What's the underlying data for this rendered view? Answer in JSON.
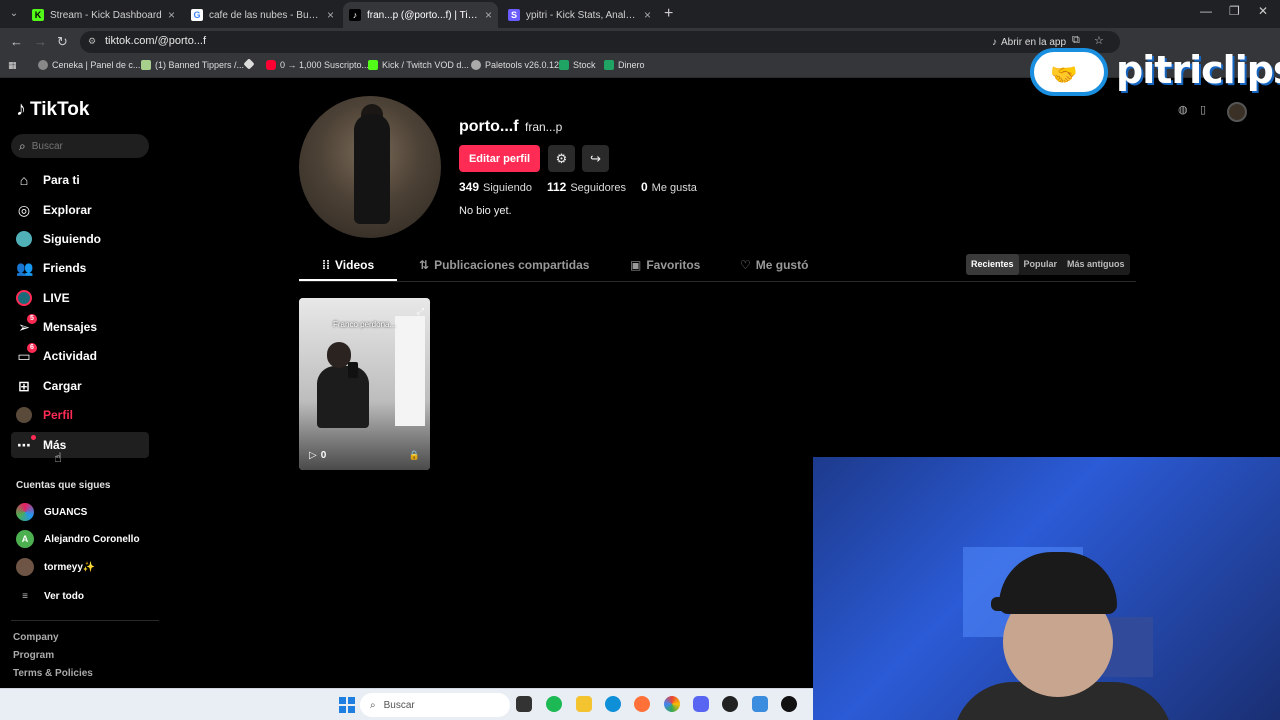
{
  "browser": {
    "tabs": [
      {
        "title": "Stream - Kick Dashboard",
        "favicon": "K",
        "color": "#53fc18"
      },
      {
        "title": "cafe de las nubes - Buscar con Google",
        "favicon": "G",
        "color": "#4285f4"
      },
      {
        "title": "fran...p (@porto...f) | TikTok",
        "favicon": "♪",
        "color": "#000000"
      },
      {
        "title": "ypitri - Kick Stats, Analytics and",
        "favicon": "S",
        "color": "#6b5cff"
      }
    ],
    "url": "tiktok.com/@porto...f",
    "open_in_app": "Abrir en la app",
    "bookmarks": [
      "Ceneka | Panel de c...",
      "(1) Banned Tippers /...",
      "",
      "0 → 1,000 Suscripto...",
      "Kick / Twitch VOD d...",
      "Paletools v26.0.12",
      "Stock",
      "Dinero"
    ]
  },
  "watermark": {
    "text": "pitriclips"
  },
  "sidebar": {
    "logo": "TikTok",
    "search_placeholder": "Buscar",
    "nav": [
      {
        "label": "Para ti",
        "icon": "home-icon"
      },
      {
        "label": "Explorar",
        "icon": "compass-icon"
      },
      {
        "label": "Siguiendo",
        "icon": "following-avatar-icon"
      },
      {
        "label": "Friends",
        "icon": "friends-icon"
      },
      {
        "label": "LIVE",
        "icon": "live-icon"
      },
      {
        "label": "Mensajes",
        "icon": "messages-icon",
        "badge": "5"
      },
      {
        "label": "Actividad",
        "icon": "activity-icon",
        "badge": "6"
      },
      {
        "label": "Cargar",
        "icon": "upload-icon"
      },
      {
        "label": "Perfil",
        "icon": "profile-avatar-icon"
      },
      {
        "label": "Más",
        "icon": "more-icon"
      }
    ],
    "following_title": "Cuentas que sigues",
    "following": [
      "GUANCS",
      "Alejandro Coronello",
      "tormeyy✨",
      "Ver todo"
    ],
    "footer": [
      "Company",
      "Program",
      "Terms & Policies"
    ]
  },
  "profile": {
    "username": "porto...f",
    "nickname": "fran...p",
    "edit_label": "Editar perfil",
    "stats": [
      {
        "value": "349",
        "label": "Siguiendo"
      },
      {
        "value": "112",
        "label": "Seguidores"
      },
      {
        "value": "0",
        "label": "Me gusta"
      }
    ],
    "bio": "No bio yet.",
    "tabs": [
      "Videos",
      "Publicaciones compartidas",
      "Favoritos",
      "Me gustó"
    ],
    "sort": [
      "Recientes",
      "Popular",
      "Más antiguos"
    ],
    "video": {
      "caption": "Franco perdona...",
      "views": "0"
    }
  },
  "taskbar": {
    "search": "Buscar"
  }
}
